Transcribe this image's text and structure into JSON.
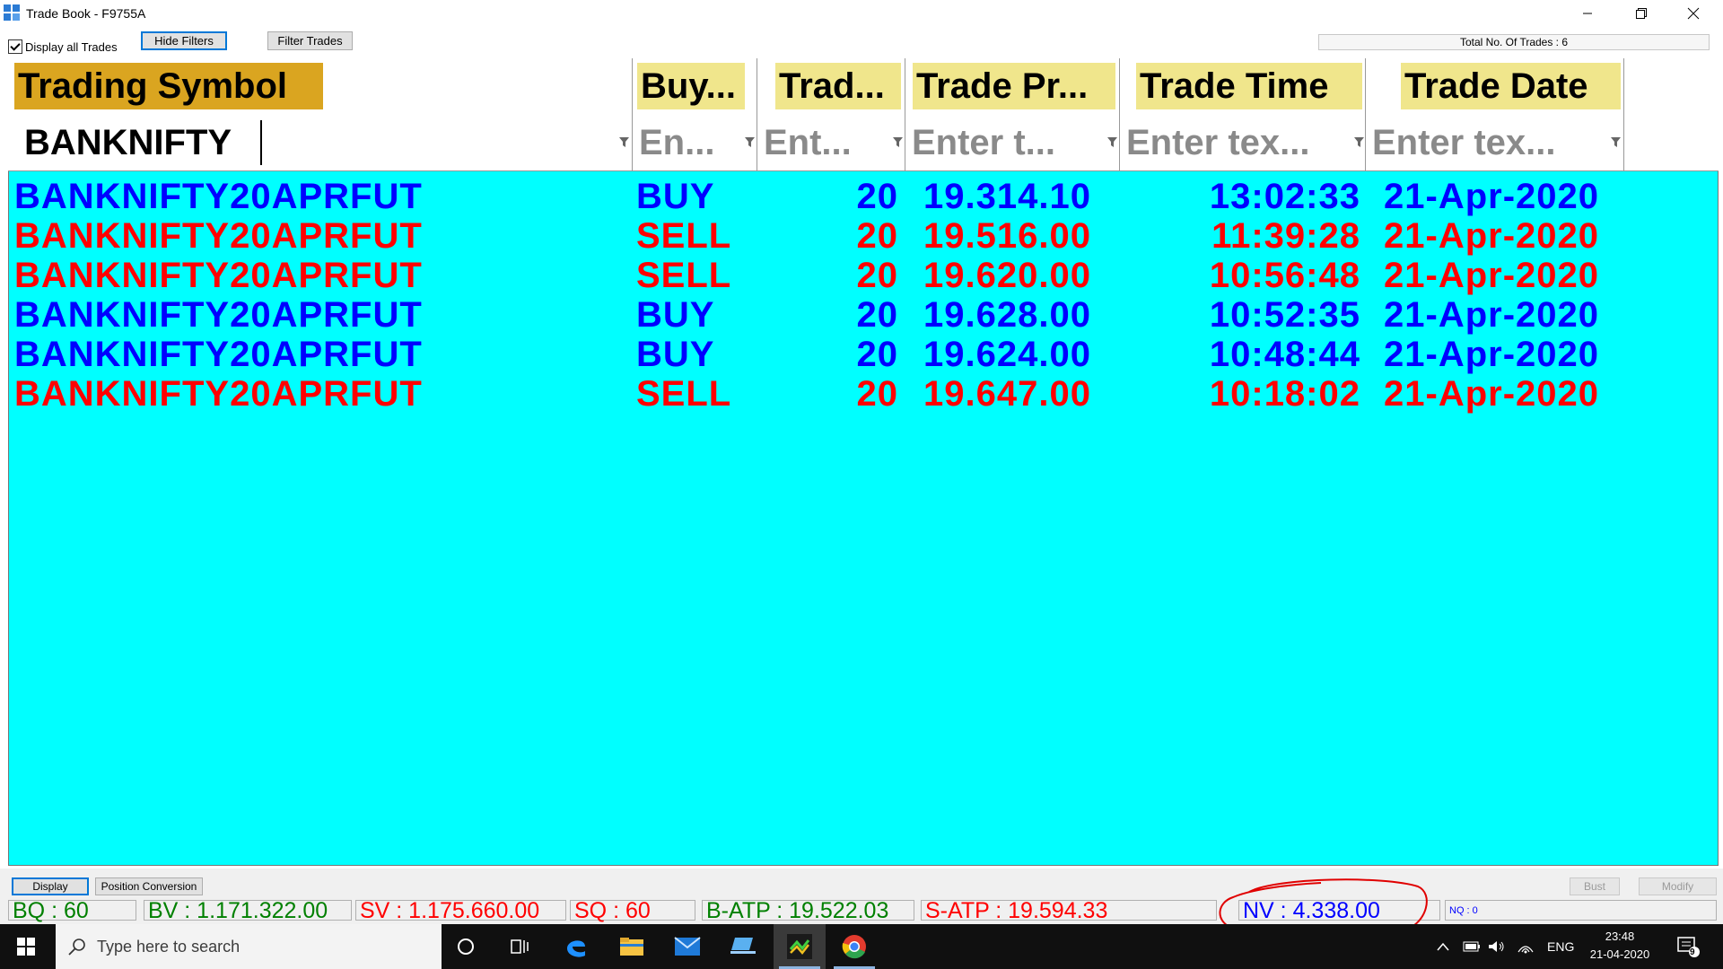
{
  "window": {
    "title": "Trade Book - F9755A"
  },
  "toolbar": {
    "display_all_label": "Display all Trades",
    "hide_filters_label": "Hide Filters",
    "filter_trades_label": "Filter Trades",
    "total_trades": "Total No. Of Trades : 6"
  },
  "columns": [
    {
      "header": "Trading Symbol",
      "header_bg": "#daa520",
      "filter": "BANKNIFTY",
      "filter_is_value": true
    },
    {
      "header": "Buy...",
      "header_bg": "#f0e68c",
      "filter": "En..."
    },
    {
      "header": "Trad...",
      "header_bg": "#f0e68c",
      "filter": "Ent..."
    },
    {
      "header": "Trade Pr...",
      "header_bg": "#f0e68c",
      "filter": "Enter t..."
    },
    {
      "header": "Trade Time",
      "header_bg": "#f0e68c",
      "filter": "Enter tex..."
    },
    {
      "header": "Trade Date",
      "header_bg": "#f0e68c",
      "filter": "Enter tex..."
    }
  ],
  "rows": [
    {
      "symbol": "BANKNIFTY20APRFUT",
      "side": "BUY",
      "qty": "20",
      "price": "19.314.10",
      "time": "13:02:33",
      "date": "21-Apr-2020"
    },
    {
      "symbol": "BANKNIFTY20APRFUT",
      "side": "SELL",
      "qty": "20",
      "price": "19.516.00",
      "time": "11:39:28",
      "date": "21-Apr-2020"
    },
    {
      "symbol": "BANKNIFTY20APRFUT",
      "side": "SELL",
      "qty": "20",
      "price": "19.620.00",
      "time": "10:56:48",
      "date": "21-Apr-2020"
    },
    {
      "symbol": "BANKNIFTY20APRFUT",
      "side": "BUY",
      "qty": "20",
      "price": "19.628.00",
      "time": "10:52:35",
      "date": "21-Apr-2020"
    },
    {
      "symbol": "BANKNIFTY20APRFUT",
      "side": "BUY",
      "qty": "20",
      "price": "19.624.00",
      "time": "10:48:44",
      "date": "21-Apr-2020"
    },
    {
      "symbol": "BANKNIFTY20APRFUT",
      "side": "SELL",
      "qty": "20",
      "price": "19.647.00",
      "time": "10:18:02",
      "date": "21-Apr-2020"
    }
  ],
  "bottom": {
    "display_label": "Display",
    "position_conversion_label": "Position Conversion",
    "bust_label": "Bust",
    "modify_label": "Modify",
    "bq": "BQ : 60",
    "bv": "BV : 1.171.322.00",
    "sv": "SV : 1.175.660.00",
    "sq": "SQ : 60",
    "batp": "B-ATP : 19.522.03",
    "satp": "S-ATP : 19.594.33",
    "nv": "NV : 4.338.00",
    "nq": "NQ : 0"
  },
  "taskbar": {
    "search_placeholder": "Type here to search",
    "language": "ENG",
    "time": "23:48",
    "date": "21-04-2020",
    "notification_count": "9"
  },
  "colors": {
    "grid_bg": "#00ffff",
    "buy": "#0000ff",
    "sell": "#ff0000",
    "annotation": "#e00000"
  }
}
